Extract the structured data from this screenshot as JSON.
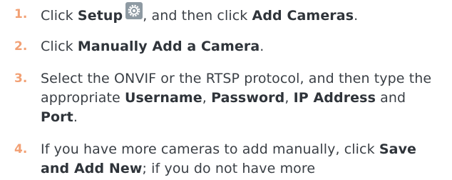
{
  "steps": [
    {
      "number": "1.",
      "parts": {
        "a": "Click ",
        "b": "Setup",
        "c": ", and then click ",
        "d": "Add Cameras",
        "e": "."
      },
      "icon": "gear-icon"
    },
    {
      "number": "2.",
      "parts": {
        "a": "Click ",
        "b": "Manually Add a Camera",
        "c": "."
      }
    },
    {
      "number": "3.",
      "parts": {
        "a": "Select the ONVIF or the RTSP protocol, and then type the appropriate ",
        "b": "Username",
        "c": ", ",
        "d": "Password",
        "e": ", ",
        "f": "IP Address",
        "g": " and ",
        "h": "Port",
        "i": "."
      }
    },
    {
      "number": "4.",
      "parts": {
        "a": "If you have more cameras to add manually, click ",
        "b": "Save and Add New",
        "c": "; if you do not have more"
      }
    }
  ],
  "colors": {
    "step_number": "#f2a074",
    "body_text": "#3a3f45",
    "icon_bg": "#8e9aa3"
  }
}
